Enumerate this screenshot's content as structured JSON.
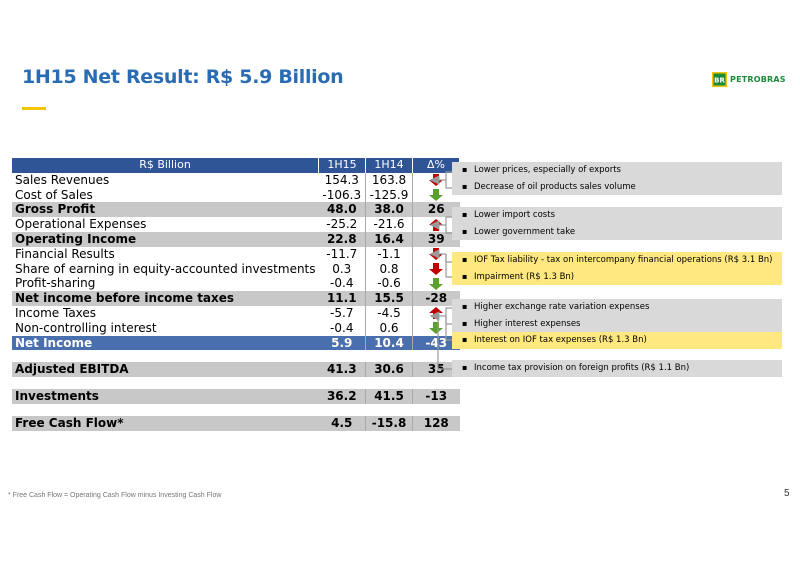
{
  "title": "1H15 Net Result: R$ 5.9 Billion",
  "logo_text": "PETROBRAS",
  "logo_mark_text": "BR",
  "table": {
    "headers": [
      "R$ Billion",
      "1H15",
      "1H14",
      "Δ%"
    ],
    "rows": [
      {
        "label": "Sales Revenues",
        "v1": "154.3",
        "v2": "163.8",
        "delta": "",
        "arrow": "down-red"
      },
      {
        "label": "Cost of Sales",
        "v1": "-106.3",
        "v2": "-125.9",
        "delta": "",
        "arrow": "down-green"
      },
      {
        "label": "Gross Profit",
        "v1": "48.0",
        "v2": "38.0",
        "delta": "26",
        "arrow": ""
      },
      {
        "label": "Operational Expenses",
        "v1": "-25.2",
        "v2": "-21.6",
        "delta": "",
        "arrow": "up-red"
      },
      {
        "label": "Operating Income",
        "v1": "22.8",
        "v2": "16.4",
        "delta": "39",
        "arrow": ""
      },
      {
        "label": "Financial Results",
        "v1": "-11.7",
        "v2": "-1.1",
        "delta": "",
        "arrow": "down-red"
      },
      {
        "label": "Share of earning in equity-accounted investments",
        "v1": "0.3",
        "v2": "0.8",
        "delta": "",
        "arrow": "down-red"
      },
      {
        "label": "Profit-sharing",
        "v1": "-0.4",
        "v2": "-0.6",
        "delta": "",
        "arrow": "down-green"
      },
      {
        "label": "Net income before income taxes",
        "v1": "11.1",
        "v2": "15.5",
        "delta": "-28",
        "arrow": ""
      },
      {
        "label": "Income Taxes",
        "v1": "-5.7",
        "v2": "-4.5",
        "delta": "",
        "arrow": "up-red"
      },
      {
        "label": "Non-controlling interest",
        "v1": "-0.4",
        "v2": "0.6",
        "delta": "",
        "arrow": "down-green"
      },
      {
        "label": "Net Income",
        "v1": "5.9",
        "v2": "10.4",
        "delta": "-43",
        "arrow": ""
      }
    ],
    "extra_rows": [
      {
        "label": "Adjusted EBITDA",
        "v1": "41.3",
        "v2": "30.6",
        "delta": "35"
      },
      {
        "label": "Investments",
        "v1": "36.2",
        "v2": "41.5",
        "delta": "-13"
      },
      {
        "label": "Free Cash Flow*",
        "v1": "4.5",
        "v2": "-15.8",
        "delta": "128"
      }
    ]
  },
  "notes": [
    [
      "Lower prices, especially of exports",
      "Decrease of oil products sales volume"
    ],
    [
      "Lower import costs",
      "Lower government take"
    ],
    [
      "IOF Tax liability - tax on intercompany financial operations (R$ 3.1 Bn)",
      "Impairment (R$ 1.3 Bn)"
    ],
    [
      "Higher exchange rate variation expenses",
      "Higher interest expenses",
      "Interest on IOF tax expenses (R$ 1.3 Bn)"
    ],
    [
      "Income tax provision on foreign profits (R$ 1.1 Bn)"
    ]
  ],
  "footnote": "* Free Cash Flow = Operating Cash Flow minus Investing Cash Flow",
  "page_number": "5",
  "colors": {
    "header_blue": "#2f5597",
    "net_income_blue": "#4a6fae",
    "title_blue": "#2a6cb3",
    "accent_yellow": "#f5c400",
    "arrow_red": "#c00000",
    "arrow_green": "#5aa02c"
  }
}
